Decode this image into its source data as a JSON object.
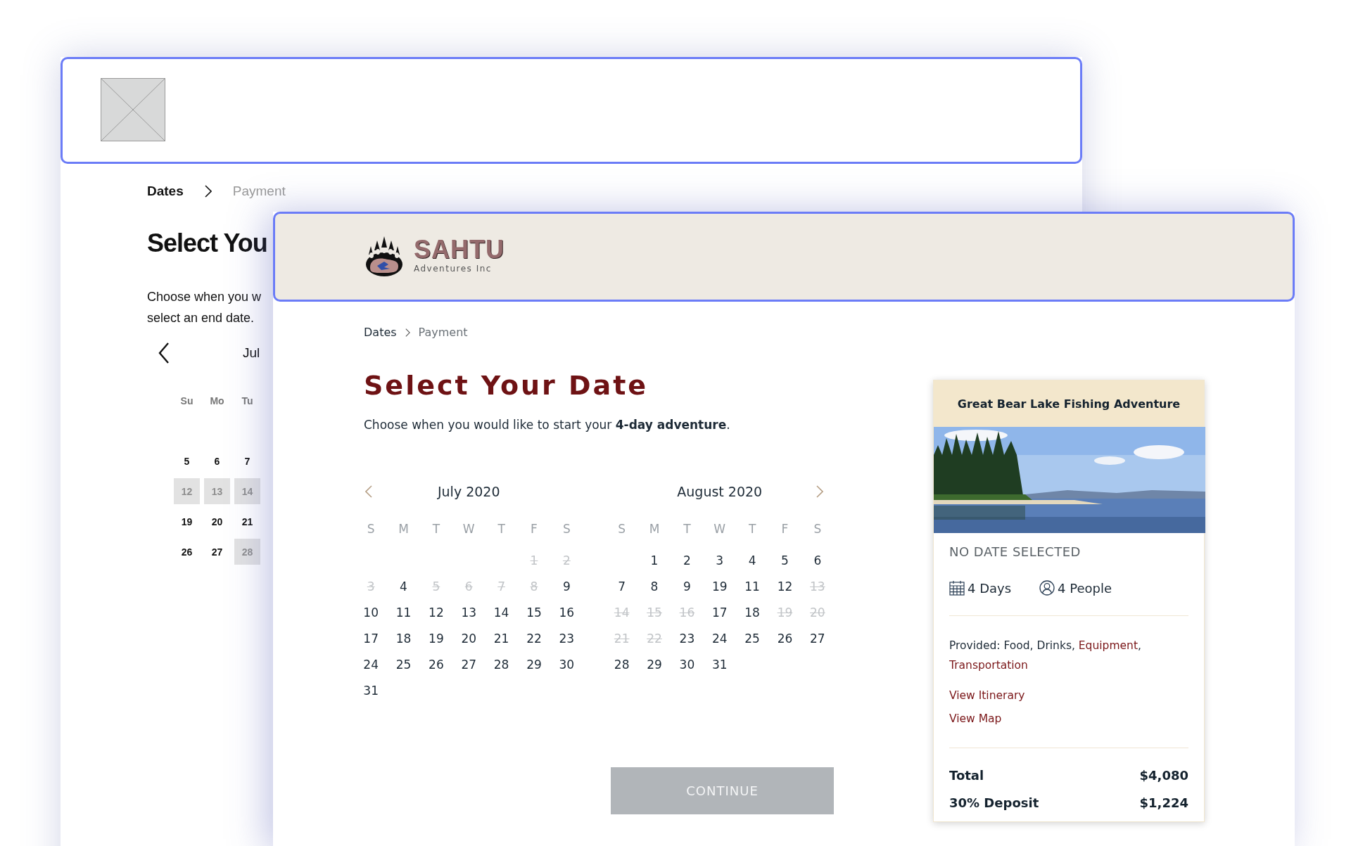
{
  "back_window": {
    "breadcrumb": [
      {
        "label": "Dates",
        "selected": true
      },
      {
        "label": "Payment",
        "selected": false
      }
    ],
    "title": "Select You",
    "description_lines": [
      "Choose when you w",
      "select an end date."
    ],
    "calendar": {
      "month": "Jul",
      "weekdays": [
        "Su",
        "Mo",
        "Tu"
      ],
      "weeks": [
        [
          {
            "day": "5",
            "disabled": false
          },
          {
            "day": "6",
            "disabled": false
          },
          {
            "day": "7",
            "disabled": false
          }
        ],
        [
          {
            "day": "12",
            "disabled": true
          },
          {
            "day": "13",
            "disabled": true
          },
          {
            "day": "14",
            "disabled": true
          }
        ],
        [
          {
            "day": "19",
            "disabled": false
          },
          {
            "day": "20",
            "disabled": false
          },
          {
            "day": "21",
            "disabled": false
          }
        ],
        [
          {
            "day": "26",
            "disabled": false
          },
          {
            "day": "27",
            "disabled": false
          },
          {
            "day": "28",
            "disabled": true
          }
        ]
      ]
    }
  },
  "front_window": {
    "logo": {
      "name": "SAHTU",
      "tagline": "Adventures Inc"
    },
    "breadcrumb": [
      {
        "label": "Dates",
        "selected": true
      },
      {
        "label": "Payment",
        "selected": false
      }
    ],
    "title": "Select Your Date",
    "subtitle": "Choose when you would like to start your **4-day adventure**.",
    "calendars": [
      {
        "month": "July 2020",
        "show_prev": true,
        "weekdays": [
          "S",
          "M",
          "T",
          "W",
          "T",
          "F",
          "S"
        ],
        "weeks": [
          {
            "fills_from_end": true,
            "days": [
              {
                "day": "1",
                "disabled": true
              },
              {
                "day": "2",
                "disabled": true
              }
            ]
          },
          {
            "days": [
              {
                "day": "3",
                "disabled": true
              },
              {
                "day": "4",
                "disabled": false
              },
              {
                "day": "5",
                "disabled": true
              },
              {
                "day": "6",
                "disabled": true
              },
              {
                "day": "7",
                "disabled": true
              },
              {
                "day": "8",
                "disabled": true
              },
              {
                "day": "9",
                "disabled": false
              }
            ]
          },
          {
            "days": [
              {
                "day": "10",
                "disabled": false
              },
              {
                "day": "11",
                "disabled": false
              },
              {
                "day": "12",
                "disabled": false
              },
              {
                "day": "13",
                "disabled": false
              },
              {
                "day": "14",
                "disabled": false
              },
              {
                "day": "15",
                "disabled": false
              },
              {
                "day": "16",
                "disabled": false
              }
            ]
          },
          {
            "days": [
              {
                "day": "17",
                "disabled": false
              },
              {
                "day": "18",
                "disabled": false
              },
              {
                "day": "19",
                "disabled": false
              },
              {
                "day": "20",
                "disabled": false
              },
              {
                "day": "21",
                "disabled": false
              },
              {
                "day": "22",
                "disabled": false
              },
              {
                "day": "23",
                "disabled": false
              }
            ]
          },
          {
            "days": [
              {
                "day": "24",
                "disabled": false
              },
              {
                "day": "25",
                "disabled": false
              },
              {
                "day": "26",
                "disabled": false
              },
              {
                "day": "27",
                "disabled": false
              },
              {
                "day": "28",
                "disabled": false
              },
              {
                "day": "29",
                "disabled": false
              },
              {
                "day": "30",
                "disabled": false
              }
            ]
          },
          {
            "fills_from_end": false,
            "days": [
              {
                "day": "31",
                "disabled": false
              }
            ]
          }
        ]
      },
      {
        "month": "August 2020",
        "show_next": true,
        "weekdays": [
          "S",
          "M",
          "T",
          "W",
          "T",
          "F",
          "S"
        ],
        "weeks": [
          {
            "fills_from_end": true,
            "days": [
              {
                "day": "1",
                "disabled": false
              },
              {
                "day": "2",
                "disabled": false
              },
              {
                "day": "3",
                "disabled": false
              },
              {
                "day": "4",
                "disabled": false
              },
              {
                "day": "5",
                "disabled": false
              },
              {
                "day": "6",
                "disabled": false
              }
            ]
          },
          {
            "days": [
              {
                "day": "7",
                "disabled": false
              },
              {
                "day": "8",
                "disabled": false
              },
              {
                "day": "9",
                "disabled": false
              },
              {
                "day": "19",
                "disabled": false
              },
              {
                "day": "11",
                "disabled": false
              },
              {
                "day": "12",
                "disabled": false
              },
              {
                "day": "13",
                "disabled": true
              }
            ]
          },
          {
            "days": [
              {
                "day": "14",
                "disabled": true
              },
              {
                "day": "15",
                "disabled": true
              },
              {
                "day": "16",
                "disabled": true
              },
              {
                "day": "17",
                "disabled": false
              },
              {
                "day": "18",
                "disabled": false
              },
              {
                "day": "19",
                "disabled": true
              },
              {
                "day": "20",
                "disabled": true
              }
            ]
          },
          {
            "days": [
              {
                "day": "21",
                "disabled": true
              },
              {
                "day": "22",
                "disabled": true
              },
              {
                "day": "23",
                "disabled": false
              },
              {
                "day": "24",
                "disabled": false
              },
              {
                "day": "25",
                "disabled": false
              },
              {
                "day": "26",
                "disabled": false
              },
              {
                "day": "27",
                "disabled": false
              }
            ]
          },
          {
            "fills_from_end": false,
            "days": [
              {
                "day": "28",
                "disabled": false
              },
              {
                "day": "29",
                "disabled": false
              },
              {
                "day": "30",
                "disabled": false
              },
              {
                "day": "31",
                "disabled": false
              }
            ]
          }
        ]
      }
    ],
    "continue_button": {
      "label": "CONTINUE",
      "disabled": true
    },
    "trip_card": {
      "title": "Great Bear Lake Fishing Adventure",
      "image": {
        "kind": "picture"
      },
      "status": "NO DATE SELECTED",
      "stats": [
        {
          "kind": "days",
          "text": "4 Days"
        },
        {
          "kind": "people",
          "text": "4 People"
        }
      ],
      "provided": {
        "label": "Provided:",
        "separator": ",",
        "items": [
          {
            "text": "Food",
            "highlighted": false
          },
          {
            "text": "Drinks",
            "highlighted": false
          },
          {
            "text": "Equipment",
            "highlighted": true
          },
          {
            "text": "Transportation",
            "highlighted": true
          }
        ]
      },
      "links": [
        "View Itinerary",
        "View Map"
      ],
      "totals": [
        {
          "label": "Total",
          "value": "$4,080"
        },
        {
          "label": "30% Deposit",
          "value": "$1,224"
        }
      ]
    }
  }
}
